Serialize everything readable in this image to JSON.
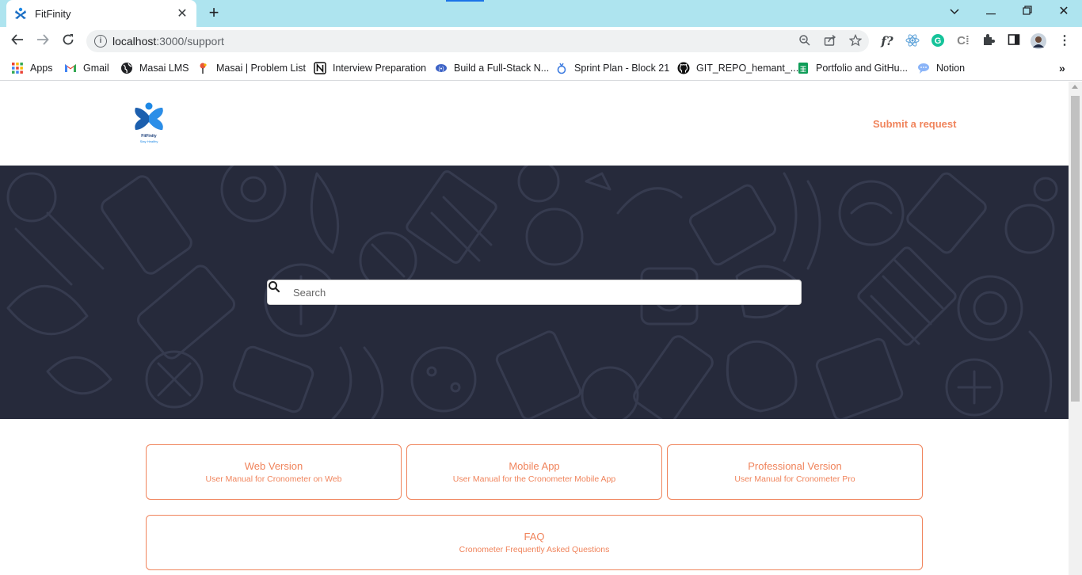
{
  "browser": {
    "tab_title": "FitFinity",
    "url_host": "localhost",
    "url_path": ":3000/support",
    "bookmarks": [
      {
        "label": "Apps",
        "icon": "apps-grid-icon"
      },
      {
        "label": "Gmail",
        "icon": "gmail-icon"
      },
      {
        "label": "Masai LMS",
        "icon": "globe-icon"
      },
      {
        "label": "Masai | Problem List",
        "icon": "masai-icon"
      },
      {
        "label": "Interview Preparation",
        "icon": "notion-n-icon"
      },
      {
        "label": "Build a Full-Stack N...",
        "icon": "link-icon"
      },
      {
        "label": "Sprint Plan - Block 21",
        "icon": "sprint-icon"
      },
      {
        "label": "GIT_REPO_hemant_...",
        "icon": "github-icon"
      },
      {
        "label": "Portfolio and GitHu...",
        "icon": "sheets-icon"
      },
      {
        "label": "Notion",
        "icon": "chat-bubble-icon"
      }
    ]
  },
  "header": {
    "logo_name": "FitFinity",
    "logo_tagline": "Stay Healthy",
    "submit_link": "Submit a request"
  },
  "hero": {
    "search_placeholder": "Search"
  },
  "cards": [
    {
      "title": "Web Version",
      "subtitle": "User Manual for Cronometer on Web"
    },
    {
      "title": "Mobile App",
      "subtitle": "User Manual for the Cronometer Mobile App"
    },
    {
      "title": "Professional Version",
      "subtitle": "User Manual for Cronometer Pro"
    },
    {
      "title": "FAQ",
      "subtitle": "Cronometer Frequently Asked Questions"
    }
  ],
  "colors": {
    "accent": "#f0845c",
    "hero_bg": "#262a3b",
    "tabbar": "#aee4ef"
  }
}
